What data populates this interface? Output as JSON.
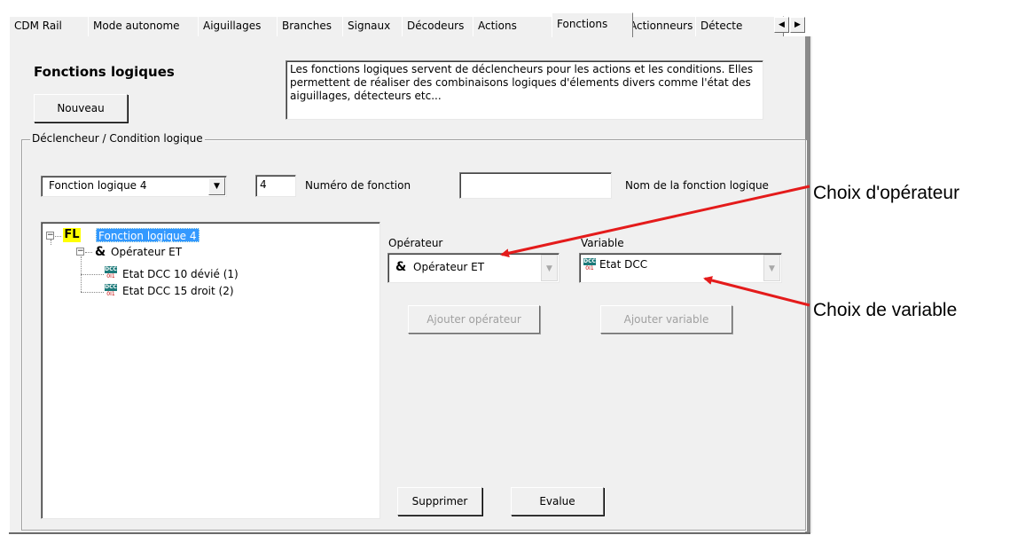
{
  "tabs": [
    {
      "label": "CDM Rail",
      "active": false
    },
    {
      "label": "Mode autonome",
      "active": false
    },
    {
      "label": "Aiguillages",
      "active": false
    },
    {
      "label": "Branches",
      "active": false
    },
    {
      "label": "Signaux",
      "active": false
    },
    {
      "label": "Décodeurs",
      "active": false
    },
    {
      "label": "Actions",
      "active": false
    },
    {
      "label": "Fonctions",
      "active": true
    },
    {
      "label": "Actionneurs",
      "active": false
    },
    {
      "label": "Détecte",
      "active": false
    }
  ],
  "header": {
    "title": "Fonctions logiques",
    "new_button": "Nouveau",
    "description": "Les fonctions logiques servent de déclencheurs pour les actions et les conditions. Elles permettent de réaliser des combinaisons logiques d'élements divers comme l'état des aiguillages, détecteurs etc..."
  },
  "group": {
    "title": "Déclencheur / Condition logique",
    "function_select_value": "Fonction logique 4",
    "function_number_value": "4",
    "function_number_label": "Numéro de fonction",
    "function_name_value": "",
    "function_name_label": "Nom de la fonction logique"
  },
  "tree": {
    "root_icon_text": "FL",
    "root_label": "Fonction logique 4",
    "operator_symbol": "&",
    "operator_label": "Opérateur ET",
    "dcc_icon_top": "DCC",
    "dcc_icon_bottom": "0I1",
    "items": [
      "Etat DCC 10 dévié (1)",
      "Etat DCC 15 droit (2)"
    ]
  },
  "editor": {
    "operator_label": "Opérateur",
    "operator_symbol": "&",
    "operator_value": "Opérateur ET",
    "variable_label": "Variable",
    "variable_value": "Etat DCC",
    "add_operator_button": "Ajouter opérateur",
    "add_variable_button": "Ajouter variable",
    "delete_button": "Supprimer",
    "evaluate_button": "Evalue"
  },
  "callouts": {
    "operator_choice": "Choix d'opérateur",
    "variable_choice": "Choix de variable"
  },
  "colors": {
    "selection": "#3399ff",
    "fl_icon_bg": "#ffff00",
    "dcc_icon_bg": "#1d7a7a",
    "arrow": "#e41b1b"
  }
}
